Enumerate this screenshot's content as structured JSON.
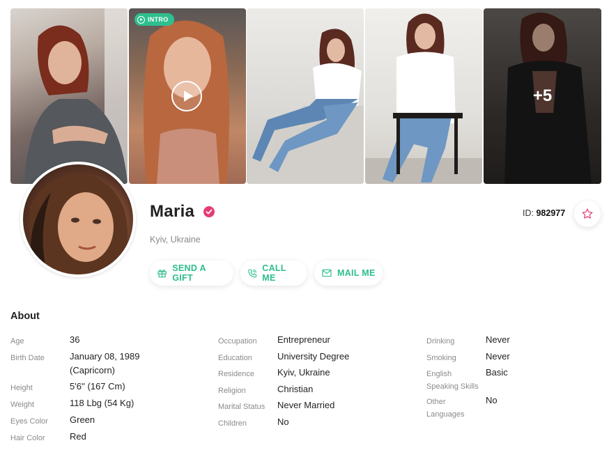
{
  "gallery": {
    "intro_badge": "INTRO",
    "more_count": "+5"
  },
  "profile": {
    "name": "Maria",
    "location": "Kyiv, Ukraine",
    "id_label": "ID:",
    "id_value": "982977"
  },
  "actions": {
    "gift": "SEND A GIFT",
    "call": "CALL ME",
    "mail": "MAIL ME"
  },
  "about": {
    "title": "About",
    "col1": [
      {
        "label": "Age",
        "value": "36"
      },
      {
        "label": "Birth Date",
        "value": "January 08, 1989",
        "value2": "(Capricorn)"
      },
      {
        "label": "Height",
        "value": "5'6'' (167 Cm)"
      },
      {
        "label": "Weight",
        "value": "118 Lbg (54 Kg)"
      },
      {
        "label": "Eyes Color",
        "value": "Green"
      },
      {
        "label": "Hair Color",
        "value": "Red"
      }
    ],
    "col2": [
      {
        "label": "Occupation",
        "value": "Entrepreneur"
      },
      {
        "label": "Education",
        "value": "University Degree"
      },
      {
        "label": "Residence",
        "value": "Kyiv, Ukraine"
      },
      {
        "label": "Religion",
        "value": "Christian"
      },
      {
        "label": "Marital Status",
        "value": "Never Married"
      },
      {
        "label": "Children",
        "value": "No"
      }
    ],
    "col3": [
      {
        "label": "Drinking",
        "value": "Never"
      },
      {
        "label": "Smoking",
        "value": "Never"
      },
      {
        "label": "English",
        "label2": "Speaking Skills",
        "value": "Basic"
      },
      {
        "label": "Other",
        "label2": "Languages",
        "value": "No"
      }
    ]
  },
  "colors": {
    "accent": "#2dbd8c",
    "verified": "#e43d73"
  }
}
